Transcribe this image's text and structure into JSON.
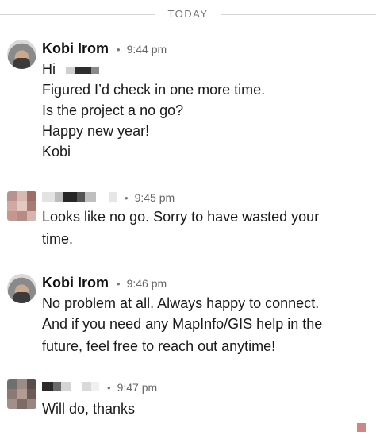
{
  "divider": {
    "label": "TODAY"
  },
  "messages": [
    {
      "sender": "Kobi Irom",
      "time": "9:44 pm",
      "lines": [
        "Hi",
        "Figured I’d check in one more time.",
        "Is the project a no go?",
        "Happy new year!",
        "Kobi"
      ]
    },
    {
      "sender": "",
      "time": "9:45 pm",
      "lines": [
        "Looks like no go.  Sorry to have wasted your",
        "time."
      ]
    },
    {
      "sender": "Kobi Irom",
      "time": "9:46 pm",
      "lines": [
        "No problem at all. Always happy to connect.",
        "And if you need any MapInfo/GIS help in the",
        "future, feel free to reach out anytime!"
      ]
    },
    {
      "sender": "",
      "time": "9:47 pm",
      "lines": [
        "Will do, thanks"
      ]
    }
  ],
  "separator_glyph": "•",
  "colors": {
    "text": "#1a1a1a",
    "meta": "#666666",
    "divider": "#d6d6d6"
  }
}
